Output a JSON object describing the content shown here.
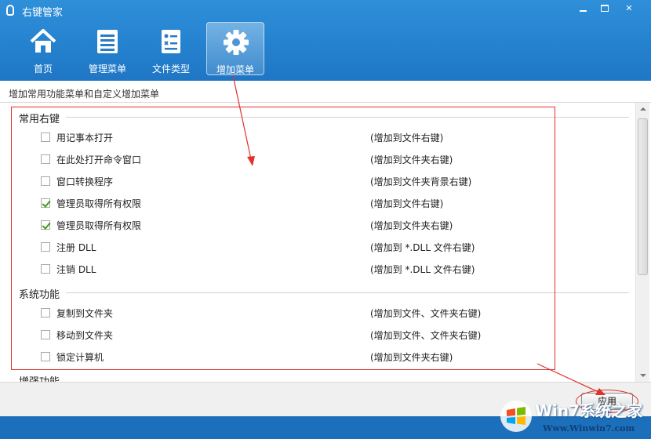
{
  "window": {
    "title": "右键管家"
  },
  "toolbar": {
    "items": [
      {
        "label": "首页",
        "icon": "home-icon"
      },
      {
        "label": "管理菜单",
        "icon": "list-icon"
      },
      {
        "label": "文件类型",
        "icon": "document-icon"
      },
      {
        "label": "增加菜单",
        "icon": "gear-icon",
        "active": true
      }
    ]
  },
  "description": "增加常用功能菜单和自定义增加菜单",
  "sections": [
    {
      "title": "常用右键",
      "items": [
        {
          "label": "用记事本打开",
          "note": "(增加到文件右键)",
          "checked": false
        },
        {
          "label": "在此处打开命令窗口",
          "note": "(增加到文件夹右键)",
          "checked": false
        },
        {
          "label": "窗口转换程序",
          "note": "(增加到文件夹背景右键)",
          "checked": false
        },
        {
          "label": "管理员取得所有权限",
          "note": "(增加到文件右键)",
          "checked": true
        },
        {
          "label": "管理员取得所有权限",
          "note": "(增加到文件夹右键)",
          "checked": true
        },
        {
          "label": "注册 DLL",
          "note": "(增加到 *.DLL 文件右键)",
          "checked": false
        },
        {
          "label": "注销 DLL",
          "note": "(增加到 *.DLL 文件右键)",
          "checked": false
        }
      ]
    },
    {
      "title": "系统功能",
      "items": [
        {
          "label": "复制到文件夹",
          "note": "(增加到文件、文件夹右键)",
          "checked": false
        },
        {
          "label": "移动到文件夹",
          "note": "(增加到文件、文件夹右键)",
          "checked": false
        },
        {
          "label": "锁定计算机",
          "note": "(增加到文件夹右键)",
          "checked": false
        }
      ]
    },
    {
      "title": "增强功能",
      "items": []
    }
  ],
  "footer": {
    "apply_label": "应用"
  },
  "watermark": {
    "brand": "Win7系统之家",
    "site": "Www.Winwin7.com"
  },
  "colors": {
    "header": "#2582cf",
    "accent_red": "#e0322a",
    "check": "#3c9a1a"
  }
}
